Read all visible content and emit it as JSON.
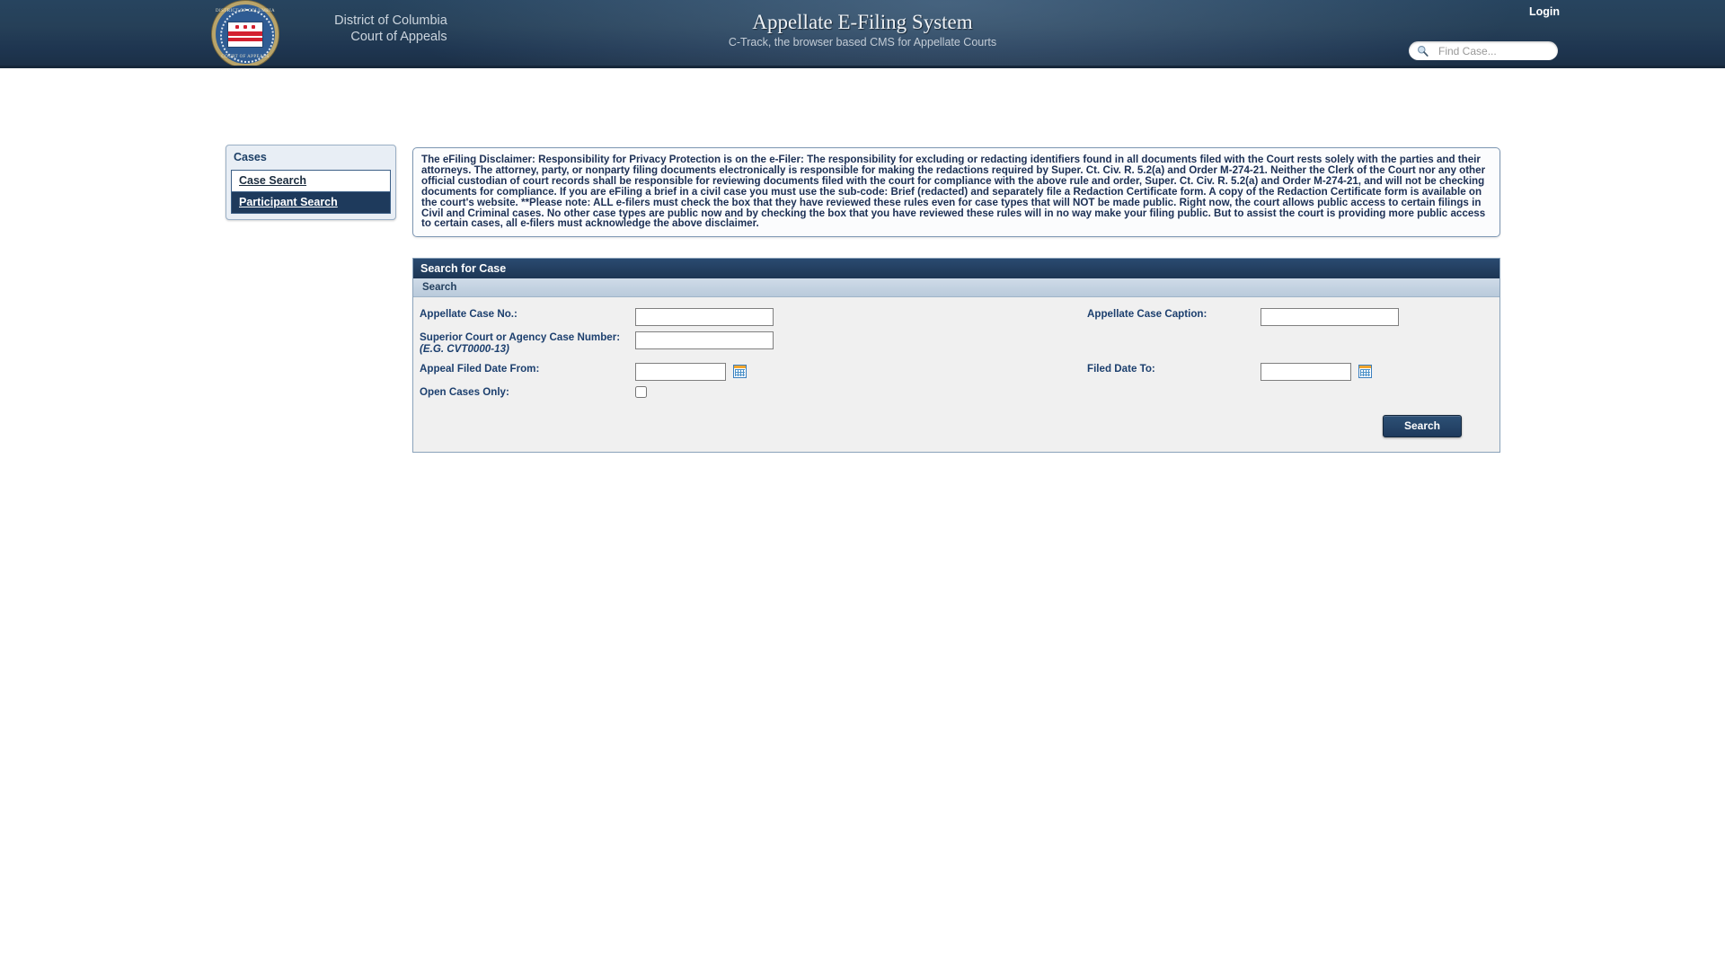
{
  "header": {
    "court_line_1": "District of Columbia",
    "court_line_2": "Court of Appeals",
    "seal_text_top": "DISTRICT OF COLUMBIA",
    "seal_text_bottom": "COURT OF APPEALS",
    "app_title": "Appellate E-Filing System",
    "app_subtitle": "C-Track, the browser based CMS for Appellate Courts",
    "login_label": "Login",
    "search": {
      "placeholder": "Find Case...",
      "value": "",
      "icon": "search-icon"
    }
  },
  "sidebar": {
    "title": "Cases",
    "items": [
      {
        "label": "Case Search",
        "selected": false
      },
      {
        "label": "Participant Search",
        "selected": true
      }
    ]
  },
  "disclaimer": {
    "text": "The eFiling Disclaimer: Responsibility for Privacy Protection is on the e-Filer: The responsibility for excluding or redacting identifiers found in all documents filed with the Court rests solely with the parties and their attorneys. The attorney, party, or nonparty filing documents electronically is responsible for making the redactions required by Super. Ct. Civ. R. 5.2(a) and Order M-274-21. Neither the Clerk of the Court nor any other official custodian of court records shall be responsible for reviewing documents filed with the court for compliance with the above rule and order, Super. Ct. Civ. R. 5.2(a) and Order M-274-21, and will not be checking documents for compliance. If you are eFiling a brief in a civil case you must use the sub-code: Brief (redacted) and separately file a Redaction Certificate form. A copy of the Redaction Certificate form is available on the court's website. **Please note: ALL e-filers must check the box that they have reviewed these rules even for case types that will NOT be made public. Right now, the court allows public access to certain filings in Civil and Criminal cases. No other case types are public now and by checking the box that you have reviewed these rules will in no way make your filing public. But to assist the court is providing more public access to certain cases, all e-filers must acknowledge the above disclaimer."
  },
  "panel": {
    "title": "Search for Case",
    "subtitle": "Search",
    "fields": {
      "appellate_case_no_label": "Appellate Case No.:",
      "appellate_case_no_value": "",
      "appellate_case_caption_label": "Appellate Case Caption:",
      "appellate_case_caption_value": "",
      "superior_court_label": "Superior Court or Agency Case Number:",
      "superior_court_hint": "(E.G. CVT0000-13)",
      "superior_court_value": "",
      "appeal_filed_date_from_label": "Appeal Filed Date From:",
      "appeal_filed_date_from_value": "",
      "filed_date_to_label": "Filed Date To:",
      "filed_date_to_value": "",
      "open_cases_only_label": "Open Cases Only:",
      "open_cases_only_checked": false
    },
    "search_button_label": "Search"
  },
  "colors": {
    "header_navy": "#1e3a5c",
    "panel_header_navy": "#24405f",
    "panel_subheader": "#c3d2e1",
    "label_blue": "#1c3f6e",
    "accent_gold": "#b9a46a",
    "flag_red": "#d32030"
  }
}
